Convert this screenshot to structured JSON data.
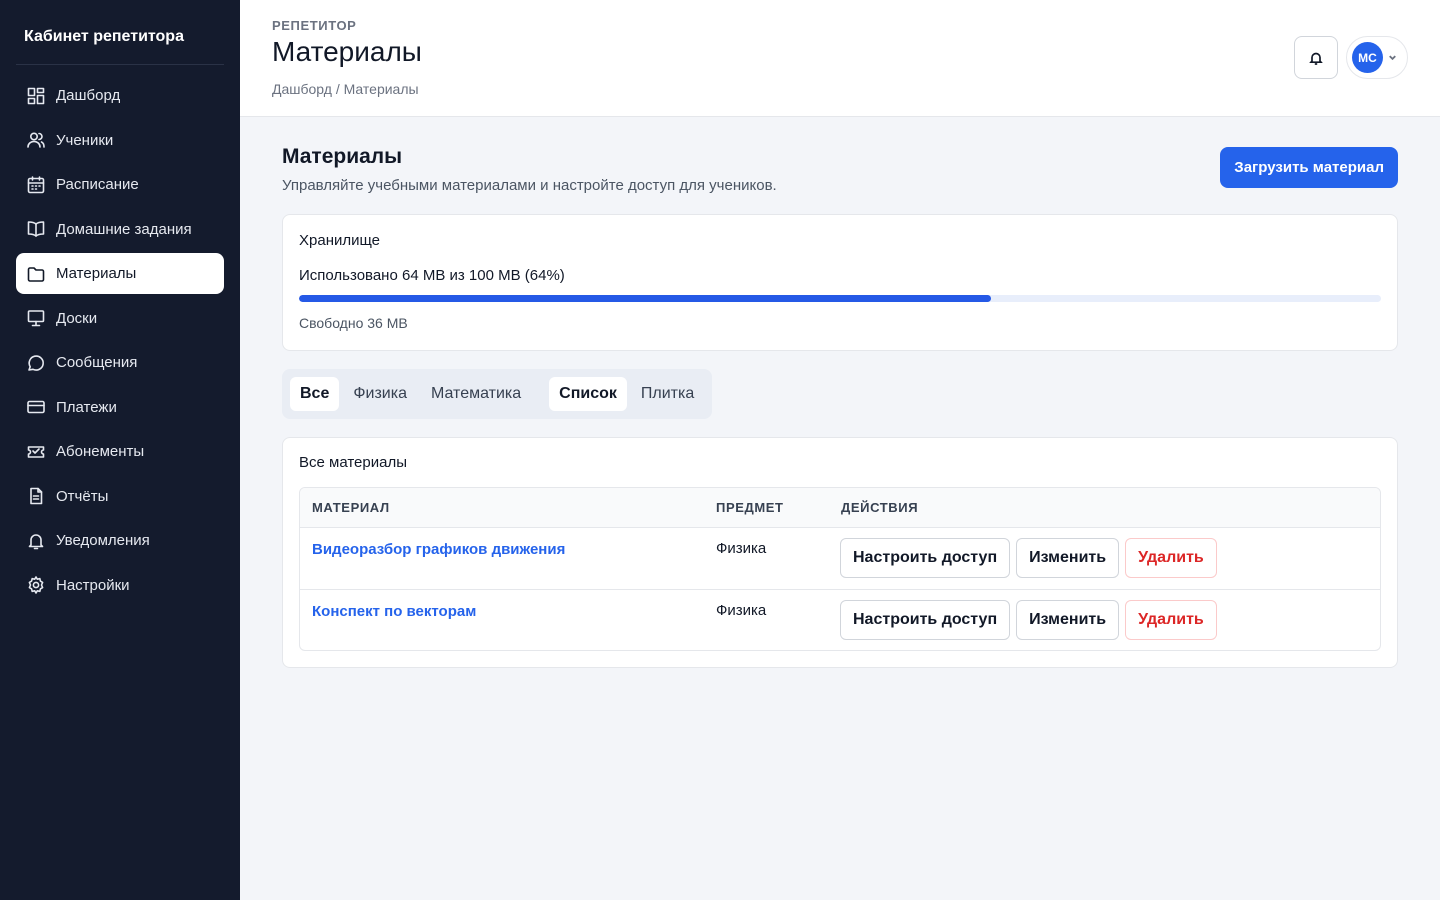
{
  "sidebar": {
    "brand": "Кабинет репетитора",
    "items": [
      {
        "label": "Дашборд",
        "icon": "dashboard-icon"
      },
      {
        "label": "Ученики",
        "icon": "users-icon"
      },
      {
        "label": "Расписание",
        "icon": "calendar-icon"
      },
      {
        "label": "Домашние задания",
        "icon": "book-icon"
      },
      {
        "label": "Материалы",
        "icon": "folder-icon",
        "active": true
      },
      {
        "label": "Доски",
        "icon": "board-icon"
      },
      {
        "label": "Сообщения",
        "icon": "chat-icon"
      },
      {
        "label": "Платежи",
        "icon": "card-icon"
      },
      {
        "label": "Абонементы",
        "icon": "ticket-icon"
      },
      {
        "label": "Отчёты",
        "icon": "report-icon"
      },
      {
        "label": "Уведомления",
        "icon": "bell-icon"
      },
      {
        "label": "Настройки",
        "icon": "gear-icon"
      }
    ]
  },
  "header": {
    "eyebrow": "РЕПЕТИТОР",
    "title": "Материалы",
    "breadcrumb": "Дашборд / Материалы",
    "avatar_initials": "МС"
  },
  "section": {
    "title": "Материалы",
    "subtitle": "Управляйте учебными материалами и настройте доступ для учеников.",
    "upload_label": "Загрузить материал"
  },
  "storage": {
    "title": "Хранилище",
    "used_text": "Использовано 64 MB из 100 MB (64%)",
    "used_fraction": 0.64,
    "free_text": "Свободно 36 MB"
  },
  "tabs": {
    "filters": [
      "Все",
      "Физика",
      "Математика"
    ],
    "active_filter": 0,
    "views": [
      "Список",
      "Плитка"
    ],
    "active_view": 0
  },
  "materials": {
    "title": "Все материалы",
    "columns": [
      "МАТЕРИАЛ",
      "ПРЕДМЕТ",
      "ДЕЙСТВИЯ"
    ],
    "rows": [
      {
        "name": "Видеоразбор графиков движения",
        "subject": "Физика"
      },
      {
        "name": "Конспект по векторам",
        "subject": "Физика"
      }
    ],
    "actions": {
      "access": "Настроить доступ",
      "edit": "Изменить",
      "delete": "Удалить"
    }
  },
  "colors": {
    "accent": "#2563eb",
    "sidebar_bg": "#141b2d",
    "danger": "#dc2626"
  }
}
